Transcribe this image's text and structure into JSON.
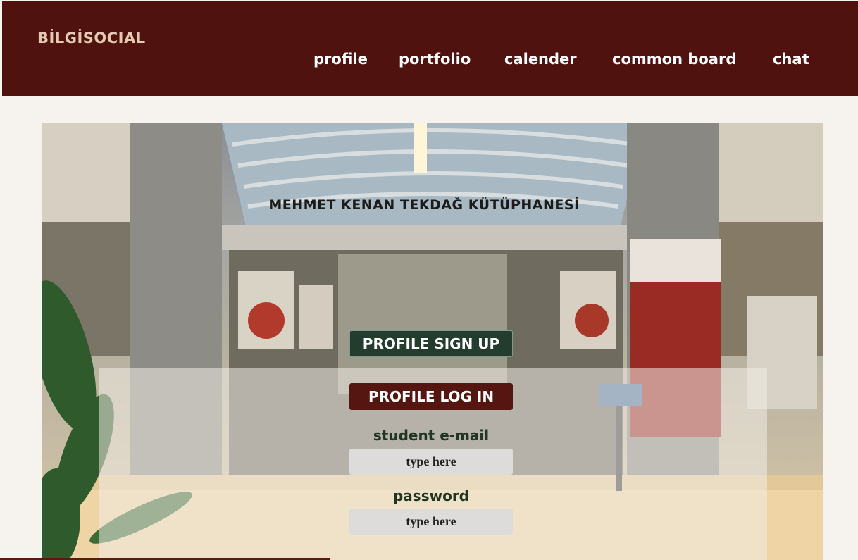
{
  "header": {
    "brand": "BİLGİSOCIAL",
    "nav": [
      "profile",
      "portfolio",
      "calender",
      "common board",
      "chat"
    ]
  },
  "hero": {
    "sign_text": "MEHMET KENAN TEKDAĞ KÜTÜPHANESİ",
    "alt": "library entrance photo"
  },
  "form": {
    "signup_label": "PROFILE SIGN UP",
    "login_label": "PROFILE LOG IN",
    "email_label": "student e-mail",
    "email_placeholder": "type here",
    "password_label": "password",
    "password_placeholder": "type here"
  },
  "colors": {
    "header_bg": "#50120e",
    "brand_text": "#e5c9b5",
    "signup_bg": "#243c2e",
    "login_bg": "#551510"
  }
}
